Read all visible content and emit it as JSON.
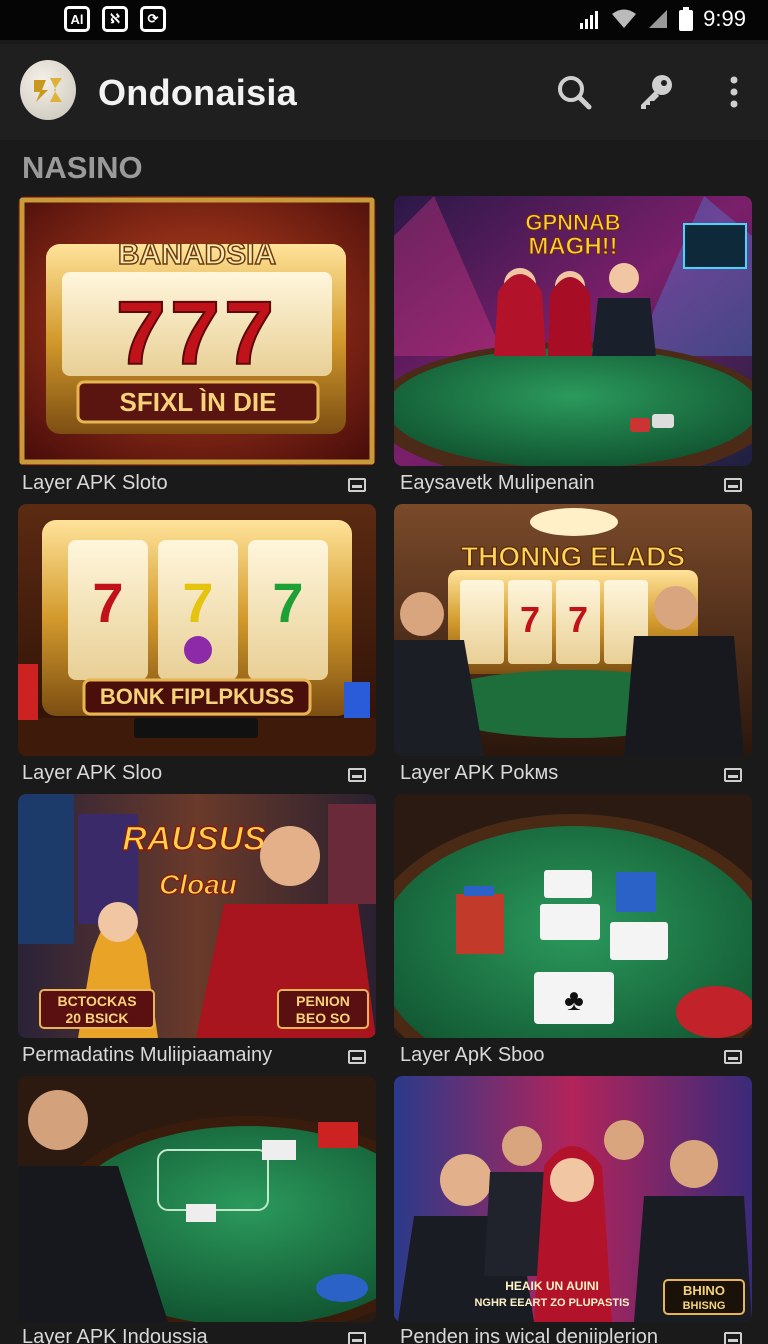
{
  "status_bar": {
    "left_icons": [
      "Al",
      "ℵ",
      "⟳"
    ],
    "time": "9:99"
  },
  "app_bar": {
    "title": "Ondonaisia",
    "actions": [
      "search-icon",
      "key-icon",
      "more-vert-icon"
    ]
  },
  "section_title": "NASINO",
  "cards": [
    {
      "caption": "Layer APK Sloto",
      "banner": "BANADSIA",
      "sub": "SFIXL ÌN DIE",
      "reels": "777"
    },
    {
      "caption": "Eaysavetk Mulipenain",
      "banner": "GPNNAB",
      "sub": "MAGH!!"
    },
    {
      "caption": "Layer APK Sloo",
      "banner": "BONK FIPLPKUSS"
    },
    {
      "caption": "Layer APK Pokмs",
      "banner": "THONNG ELADS"
    },
    {
      "caption": "Permadatins Muliipiaamainy",
      "banner": "RAUSUS",
      "sub": "Cloau",
      "badge_left": [
        "BCTOCKAS",
        "20 BSICK"
      ],
      "badge_right": [
        "PENION",
        "BEO SO"
      ]
    },
    {
      "caption": "Layer ApK Sboo"
    },
    {
      "caption": "Layer APK Indoussia"
    },
    {
      "caption": "Penden ins wical deniiplerion",
      "badge_right": [
        "BHINO",
        "BHISNG"
      ],
      "bottom_text": [
        "HEAIK UN AUINI",
        "NGHR EEART ZO PLUPASTIS"
      ]
    }
  ]
}
